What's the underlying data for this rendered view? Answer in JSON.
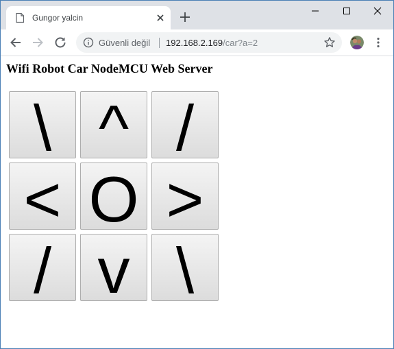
{
  "browser": {
    "tab": {
      "title": "Gungor yalcin"
    },
    "address_bar": {
      "security_label": "Güvenli değil",
      "url_host": "192.168.2.169",
      "url_path": "/car?a=2"
    }
  },
  "page": {
    "heading": "Wifi Robot Car NodeMCU Web Server",
    "controls": [
      {
        "label": "\\"
      },
      {
        "label": "^"
      },
      {
        "label": "/"
      },
      {
        "label": "<"
      },
      {
        "label": "O"
      },
      {
        "label": ">"
      },
      {
        "label": "/"
      },
      {
        "label": "v"
      },
      {
        "label": "\\"
      }
    ]
  }
}
